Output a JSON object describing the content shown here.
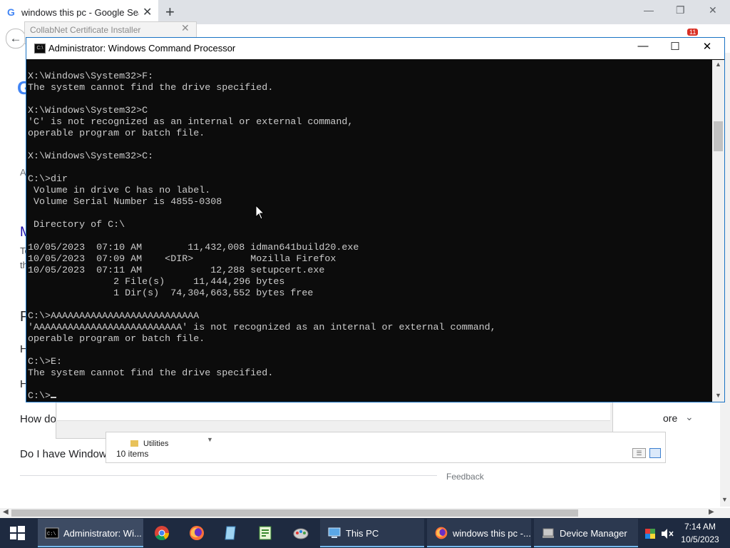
{
  "browser": {
    "tab_title": "windows this pc - Google Search",
    "tab_favicon": "G",
    "close_glyph": "✕",
    "new_tab_glyph": "+",
    "back_glyph": "←",
    "minimize_glyph": "—",
    "restore_glyph": "❐",
    "window_close_glyph": "✕",
    "extension_badge": "11",
    "google_logo_letter": "G",
    "results": [
      {
        "text": "A"
      },
      {
        "text": "M"
      },
      {
        "text": "To"
      },
      {
        "text": "th"
      },
      {
        "text": "P"
      },
      {
        "text": "H"
      },
      {
        "text": "H"
      },
      {
        "text": "How do"
      },
      {
        "text": "Do I have Window"
      }
    ],
    "more_label": "ore",
    "feedback": "Feedback"
  },
  "collabnet": {
    "title": "CollabNet Certificate Installer",
    "close_glyph": "✕"
  },
  "explorer": {
    "folder_label": "Utilities",
    "items_count": "10 items",
    "details_icon": "details-view-icon",
    "large_icons_icon": "large-icons-view-icon"
  },
  "cmd": {
    "title": "Administrator: Windows Command Processor",
    "minimize_glyph": "—",
    "maximize_glyph": "☐",
    "close_glyph": "✕",
    "icon_text": "C:\\",
    "lines": [
      "X:\\Windows\\System32>F:",
      "The system cannot find the drive specified.",
      "",
      "X:\\Windows\\System32>C",
      "'C' is not recognized as an internal or external command,",
      "operable program or batch file.",
      "",
      "X:\\Windows\\System32>C:",
      "",
      "C:\\>dir",
      " Volume in drive C has no label.",
      " Volume Serial Number is 4855-0308",
      "",
      " Directory of C:\\",
      "",
      "10/05/2023  07:10 AM        11,432,008 idman641build20.exe",
      "10/05/2023  07:09 AM    <DIR>          Mozilla Firefox",
      "10/05/2023  07:11 AM            12,288 setupcert.exe",
      "               2 File(s)     11,444,296 bytes",
      "               1 Dir(s)  74,304,663,552 bytes free",
      "",
      "C:\\>AAAAAAAAAAAAAAAAAAAAAAAAAA",
      "'AAAAAAAAAAAAAAAAAAAAAAAAAA' is not recognized as an internal or external command,",
      "operable program or batch file.",
      "",
      "C:\\>E:",
      "The system cannot find the drive specified.",
      ""
    ],
    "prompt": "C:\\>"
  },
  "taskbar": {
    "cmd_label": "Administrator: Wi...",
    "thispc_label": "This PC",
    "firefox_label": "windows this pc -...",
    "devmgr_label": "Device Manager",
    "pinned": [
      "chrome-icon",
      "firefox-icon",
      "notepad-icon",
      "spreadsheet-icon",
      "paint-icon"
    ],
    "time": "7:14 AM",
    "date": "10/5/2023"
  },
  "colors": {
    "taskbar_bg": "#1e2a40",
    "cmd_bg": "#0c0c0c",
    "cmd_text": "#cccccc",
    "accent": "#76b9ed"
  }
}
